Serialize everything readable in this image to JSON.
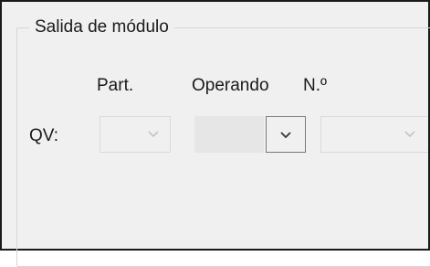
{
  "groupbox": {
    "title": "Salida de módulo"
  },
  "headers": {
    "part": "Part.",
    "operando": "Operando",
    "numero": "N.º"
  },
  "row": {
    "label": "QV:",
    "part": {
      "value": "",
      "enabled": false
    },
    "operando": {
      "value": "",
      "enabled": true
    },
    "numero": {
      "value": "",
      "enabled": false
    }
  },
  "icons": {
    "dropdown": "chevron-down-icon"
  },
  "colors": {
    "panel_bg": "#f0f0f0",
    "disabled_border": "#dadada",
    "active_border": "#7a7a7a",
    "text": "#1a1a1a"
  }
}
